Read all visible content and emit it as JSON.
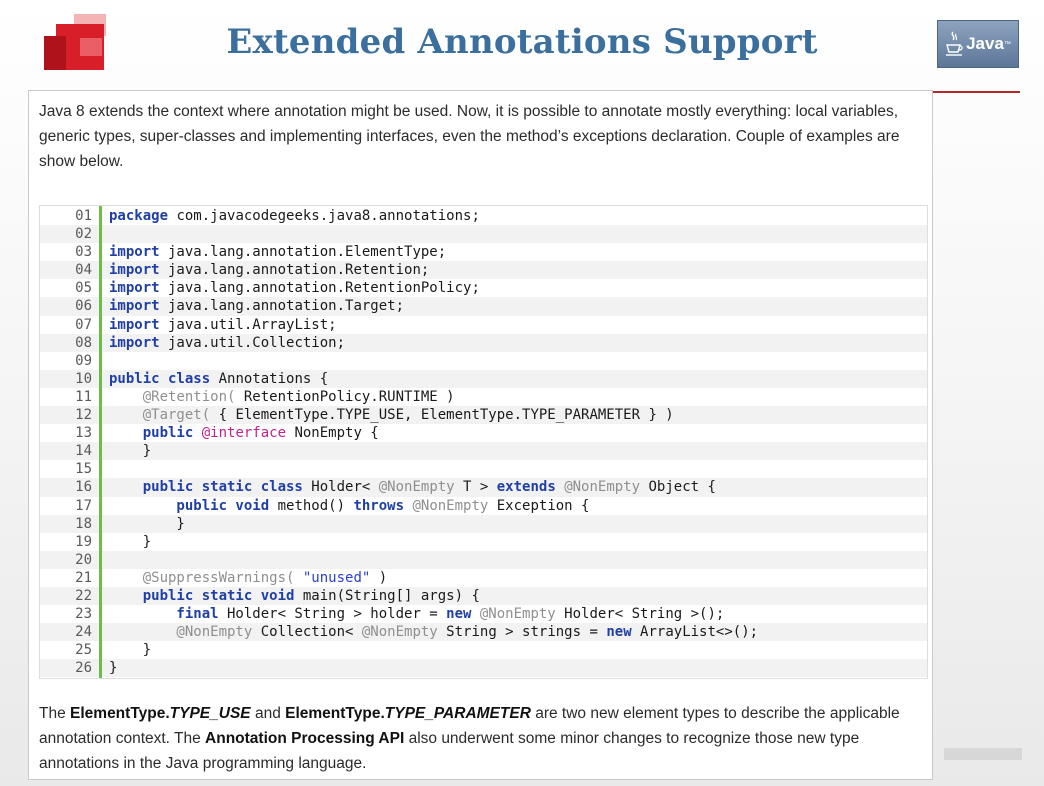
{
  "header": {
    "title": "Extended Annotations Support",
    "java_logo": "Java",
    "java_tm": "™"
  },
  "colors": {
    "title": "#3b6f9d",
    "accent_red": "#d81e28",
    "gutter_bar": "#6cbe45",
    "keyword": "#1f3fa6",
    "annotation": "#8f8f8f",
    "annotation_keyword": "#c31f8f",
    "string": "#2a3dd6"
  },
  "intro_text": "Java 8 extends the context where annotation might be used. Now, it is possible to annotate mostly everything: local variables, generic types, super-classes and implementing interfaces, even the method’s exceptions declaration. Couple of examples are show below.",
  "code": {
    "lines": [
      {
        "n": "01",
        "t": [
          [
            "kw",
            "package"
          ],
          [
            "",
            "com.javacodegeeks.java8.annotations;"
          ]
        ]
      },
      {
        "n": "02",
        "t": []
      },
      {
        "n": "03",
        "t": [
          [
            "kw",
            "import"
          ],
          [
            "",
            "java.lang.annotation.ElementType;"
          ]
        ]
      },
      {
        "n": "04",
        "t": [
          [
            "kw",
            "import"
          ],
          [
            "",
            "java.lang.annotation.Retention;"
          ]
        ]
      },
      {
        "n": "05",
        "t": [
          [
            "kw",
            "import"
          ],
          [
            "",
            "java.lang.annotation.RetentionPolicy;"
          ]
        ]
      },
      {
        "n": "06",
        "t": [
          [
            "kw",
            "import"
          ],
          [
            "",
            "java.lang.annotation.Target;"
          ]
        ]
      },
      {
        "n": "07",
        "t": [
          [
            "kw",
            "import"
          ],
          [
            "",
            "java.util.ArrayList;"
          ]
        ]
      },
      {
        "n": "08",
        "t": [
          [
            "kw",
            "import"
          ],
          [
            "",
            "java.util.Collection;"
          ]
        ]
      },
      {
        "n": "09",
        "t": []
      },
      {
        "n": "10",
        "t": [
          [
            "kw",
            "public"
          ],
          [
            "kw",
            "class"
          ],
          [
            "",
            "Annotations {"
          ]
        ]
      },
      {
        "n": "11",
        "t": [
          [
            "an",
            "    @Retention("
          ],
          [
            "",
            "RetentionPolicy.RUNTIME )"
          ]
        ]
      },
      {
        "n": "12",
        "t": [
          [
            "an",
            "    @Target("
          ],
          [
            "",
            "{ ElementType.TYPE_USE, ElementType.TYPE_PARAMETER } )"
          ]
        ]
      },
      {
        "n": "13",
        "t": [
          [
            "kw",
            "    public"
          ],
          [
            "ai",
            "@interface"
          ],
          [
            "",
            "NonEmpty {"
          ]
        ]
      },
      {
        "n": "14",
        "t": [
          [
            "",
            "    }"
          ]
        ]
      },
      {
        "n": "15",
        "t": []
      },
      {
        "n": "16",
        "t": [
          [
            "kw",
            "    public static class"
          ],
          [
            "",
            "Holder<"
          ],
          [
            "an",
            "@NonEmpty"
          ],
          [
            "",
            "T >"
          ],
          [
            "kw",
            "extends"
          ],
          [
            "an",
            "@NonEmpty"
          ],
          [
            "",
            "Object {"
          ]
        ]
      },
      {
        "n": "17",
        "t": [
          [
            "kw",
            "        public void"
          ],
          [
            "",
            "method()"
          ],
          [
            "kw",
            "throws"
          ],
          [
            "an",
            "@NonEmpty"
          ],
          [
            "",
            "Exception {"
          ]
        ]
      },
      {
        "n": "18",
        "t": [
          [
            "",
            "        }"
          ]
        ]
      },
      {
        "n": "19",
        "t": [
          [
            "",
            "    }"
          ]
        ]
      },
      {
        "n": "20",
        "t": []
      },
      {
        "n": "21",
        "t": [
          [
            "an",
            "    @SuppressWarnings("
          ],
          [
            "st",
            "\"unused\""
          ],
          [
            "",
            ")"
          ]
        ]
      },
      {
        "n": "22",
        "t": [
          [
            "kw",
            "    public static void"
          ],
          [
            "",
            "main(String[] args) {"
          ]
        ]
      },
      {
        "n": "23",
        "t": [
          [
            "kw",
            "        final"
          ],
          [
            "",
            "Holder< String > holder ="
          ],
          [
            "kw",
            "new"
          ],
          [
            "an",
            "@NonEmpty"
          ],
          [
            "",
            "Holder< String >();"
          ]
        ]
      },
      {
        "n": "24",
        "t": [
          [
            "an",
            "        @NonEmpty"
          ],
          [
            "",
            "Collection<"
          ],
          [
            "an",
            "@NonEmpty"
          ],
          [
            "",
            "String > strings ="
          ],
          [
            "kw",
            "new"
          ],
          [
            "",
            "ArrayList<>();"
          ]
        ]
      },
      {
        "n": "25",
        "t": [
          [
            "",
            "    }"
          ]
        ]
      },
      {
        "n": "26",
        "t": [
          [
            "",
            "}"
          ]
        ]
      }
    ]
  },
  "outro": {
    "p1": "The ",
    "b1": "ElementType.",
    "i1": "TYPE_USE",
    "p2": " and ",
    "b2": "ElementType.",
    "i2": "TYPE_PARAMETER",
    "p3": " are two new element types to describe the applicable annotation context. The ",
    "b3": "Annotation Processing API",
    "p4": " also underwent some minor changes to recognize those new type annotations in the Java programming language."
  }
}
